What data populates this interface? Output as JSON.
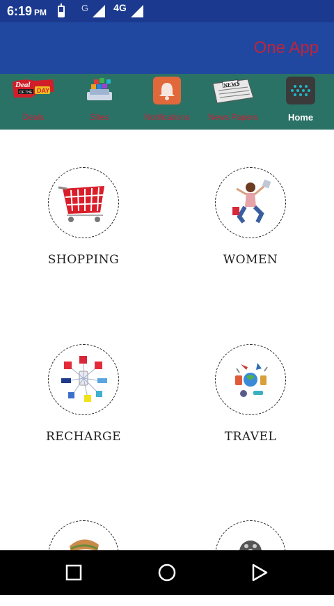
{
  "status_bar": {
    "time": "6:19",
    "ampm": "PM",
    "network_g": "G",
    "network_4g": "4G"
  },
  "app_bar": {
    "title": "One App"
  },
  "icon_bar": {
    "items": [
      {
        "label": "Deals",
        "icon": "deal-of-the-day-icon",
        "badge_top": "Deal",
        "badge_mid": "OF THE",
        "badge_day": "DAY"
      },
      {
        "label": "Sites",
        "icon": "apps-cube-icon"
      },
      {
        "label": "Notifications",
        "icon": "bell-icon"
      },
      {
        "label": "News Papers",
        "icon": "newspaper-icon",
        "badge": "NEWS"
      },
      {
        "label": "Home",
        "icon": "grid-dots-icon"
      }
    ],
    "page_indicator": {
      "pages": 2,
      "active": 1
    }
  },
  "categories": [
    {
      "label": "SHOPPING",
      "icon": "shopping-basket-icon"
    },
    {
      "label": "WOMEN",
      "icon": "woman-shopping-icon"
    },
    {
      "label": "RECHARGE",
      "icon": "recharge-operators-icon"
    },
    {
      "label": "TRAVEL",
      "icon": "travel-icon"
    },
    {
      "label": "",
      "icon": "food-icon"
    },
    {
      "label": "",
      "icon": "film-reel-icon"
    }
  ],
  "nav_bar": {
    "recents": "square-icon",
    "home": "circle-icon",
    "back": "triangle-icon"
  },
  "colors": {
    "status_bar": "#1b3a8f",
    "app_bar": "#2048a0",
    "icon_bar": "#2b7266",
    "title_accent": "#c0243b"
  }
}
